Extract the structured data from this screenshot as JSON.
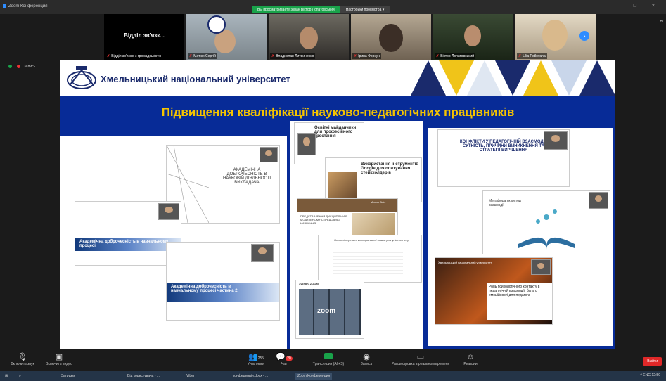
{
  "window": {
    "app_title": "Zoom Конференция",
    "side_label": "Ві",
    "controls": "– □ ×"
  },
  "share_banner": {
    "viewing_text": "Вы просматриваете экран Віктор Лопатовський",
    "options_label": "Настройки просмотра ▾"
  },
  "participants": [
    {
      "name": "Відділ зв'язків з громадськістю",
      "big_name": "Відділ зв'язк..."
    },
    {
      "name": "Матюх Сергій"
    },
    {
      "name": "Владислав Литвиненко"
    },
    {
      "name": "Ірина Форкун"
    },
    {
      "name": "Віктор Лопатовський"
    },
    {
      "name": "Lilia Petlovana"
    }
  ],
  "status": {
    "record": "Запись"
  },
  "slide": {
    "university": "Хмельницький національний університет",
    "headline": "Підвищення кваліфікації науково-педагогічних працівників",
    "left": {
      "doc_title": "АКАДЕМІЧНА ДОБРОЧЕСНІСТЬ В НАУКОВІЙ ДІЯЛЬНОСТІ ВИКЛАДАЧА",
      "card1": "Академічна доброчесність в навчальному процесі",
      "card2": "Академічна доброчесність в навчальному процесі частина 2"
    },
    "middle": {
      "c1": "Освітні майданчики для професійного зростання",
      "c2": "Використання інструментів Google для опитування стейкхолдерів",
      "c3": "ПРЕДСТАВЛЕННЯ ДИСЦИПЛІНИ В МОДУЛЬНОМУ СЕРЕДОВИЩІ НАВЧАННЯ",
      "c3_author": "Матюх Бліх",
      "c4": "Основні переваги корпоративної пошти для університету",
      "c5": "Зустріч ZOOM",
      "c5_big": "zoom"
    },
    "right": {
      "c1": "КОНФЛІКТИ У ПЕДАГОГІЧНІЙ ВЗАЄМОДІЇ: СУТНІСТЬ, ПРИЧИНИ ВИНИКНЕННЯ ТА СТРАТЕГІЇ ВИРІШЕННЯ",
      "c2": "Метафора як метод взаємодії",
      "c3_top": "Хмельницький національний університет",
      "c3": "Роль психологічного контакту в педагогічній взаємодії: багато емоційності для педагога"
    }
  },
  "toolbar": {
    "mic": "Включить звук",
    "video": "Включить видео",
    "participants": "Участники",
    "participants_count": "255",
    "chat": "Чат",
    "chat_badge": "20",
    "share": "Трансляция (Alt+S)",
    "record": "Запись",
    "captions": "Расшифровка в реальном времени",
    "reactions": "Реакции",
    "leave": "Выйти"
  },
  "taskbar": {
    "items": [
      "Загрузки",
      "Від користувача - ...",
      "Viber",
      "конференція.docx - ...",
      "Zoom Конференция"
    ],
    "tray": "^ ENG 12:50"
  },
  "colors": {
    "slide_blue": "#072b97",
    "headline": "#f5c400",
    "zoom_blue": "#2d8cff",
    "share_green": "#19a34a",
    "leave_red": "#e02828"
  }
}
